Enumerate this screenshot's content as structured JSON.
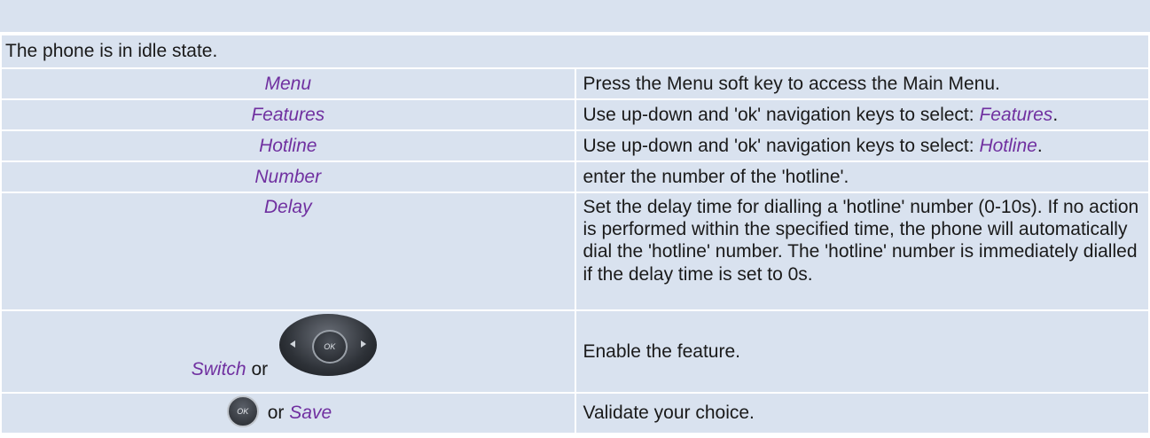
{
  "header": {
    "text": "The phone is in idle state."
  },
  "rows": [
    {
      "key": "Menu",
      "desc": "Press the Menu soft key to access the Main Menu."
    },
    {
      "key": "Features",
      "desc_prefix": "Use up-down and 'ok' navigation keys to select: ",
      "desc_em": "Features",
      "desc_suffix": "."
    },
    {
      "key": "Hotline",
      "desc_prefix": "Use up-down and 'ok' navigation keys to select: ",
      "desc_em": "Hotline",
      "desc_suffix": "."
    },
    {
      "key": "Number",
      "desc": "enter the number of the 'hotline'."
    },
    {
      "key": "Delay",
      "desc": "Set the delay time for dialling a 'hotline' number (0-10s). If no action is performed within the specified time, the phone will automatically dial the 'hotline' number. The 'hotline' number is immediately dialled if the delay time is set to 0s."
    }
  ],
  "switch_row": {
    "key_em": "Switch",
    "key_or": " or",
    "navpad_label": "OK",
    "desc": "Enable the feature."
  },
  "save_row": {
    "ok_label": "OK",
    "key_or": "or ",
    "key_em": "Save",
    "desc": "Validate your choice."
  },
  "colors": {
    "cell_bg": "#d9e2ef",
    "accent": "#7030a0",
    "text": "#1a1a1a"
  },
  "icons": [
    "navigation-keypad-icon",
    "ok-button-icon"
  ]
}
